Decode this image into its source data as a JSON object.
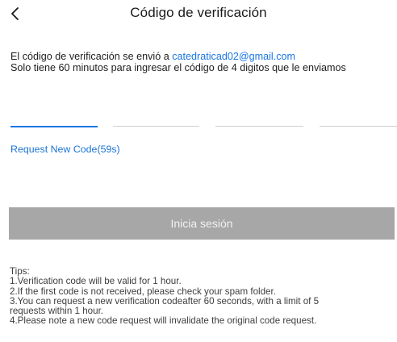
{
  "header": {
    "back_icon": "chevron-left-icon",
    "title": "Código de verificación"
  },
  "info": {
    "line1_prefix": "El código de verificación se envió a ",
    "email": "catedraticad02@gmail.com",
    "line2": "Solo tiene 60 minutos para ingresar el código de 4 digitos que le enviamos"
  },
  "code_inputs": {
    "count": 4,
    "active_index": 0,
    "active_color": "#1976e3",
    "inactive_color": "#cfcfcf"
  },
  "request_new_code": "Request New Code(59s)",
  "login_button": {
    "label": "Inicia sesión",
    "background": "#a7a7a7"
  },
  "tips": {
    "title": "Tips:",
    "items": [
      "1.Verification code will be valid for 1 hour.",
      "2.If the first code is not received, please check your spam folder.",
      "3.You can request a new verification codeafter 60 seconds, with a limit of 5\nrequests within 1 hour.",
      "4.Please note a new code request will invalidate the original code request."
    ]
  },
  "colors": {
    "accent": "#1976e3",
    "button_disabled": "#a7a7a7"
  }
}
